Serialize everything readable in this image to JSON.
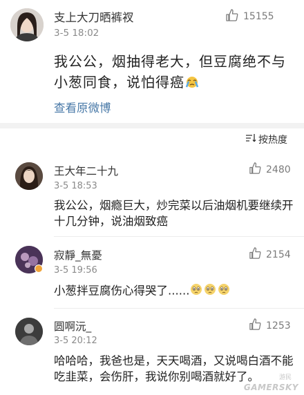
{
  "post": {
    "author": "支上大刀晒裤衩",
    "time": "3-5 18:02",
    "likes": "15155",
    "text": "我公公，烟抽得老大，但豆腐绝不与小葱同食，说怕得癌",
    "link": "查看原微博"
  },
  "sort": {
    "label": "按热度",
    "icon": "sort-icon"
  },
  "comments": [
    {
      "author": "王大年二十九",
      "time": "3-5 18:53",
      "likes": "2480",
      "text": "我公公，烟瘾巨大，炒完菜以后油烟机要继续开十几分钟，说油烟致癌"
    },
    {
      "author": "寂靜_無憂",
      "time": "3-5 19:56",
      "likes": "2154",
      "text": "小葱拌豆腐伤心得哭了......"
    },
    {
      "author": "圆啊沅_",
      "time": "3-5 20:12",
      "likes": "1253",
      "text": "哈哈哈，我爸也是，天天喝酒，又说喝白酒不能吃韭菜，会伤肝，我说你别喝酒就好了。"
    }
  ],
  "watermark": {
    "main": "GAMERSKY",
    "small": "游民"
  },
  "colors": {
    "link": "#4a7aa8",
    "muted": "#8a8a8a",
    "divider_bg": "#f2f2f2"
  }
}
